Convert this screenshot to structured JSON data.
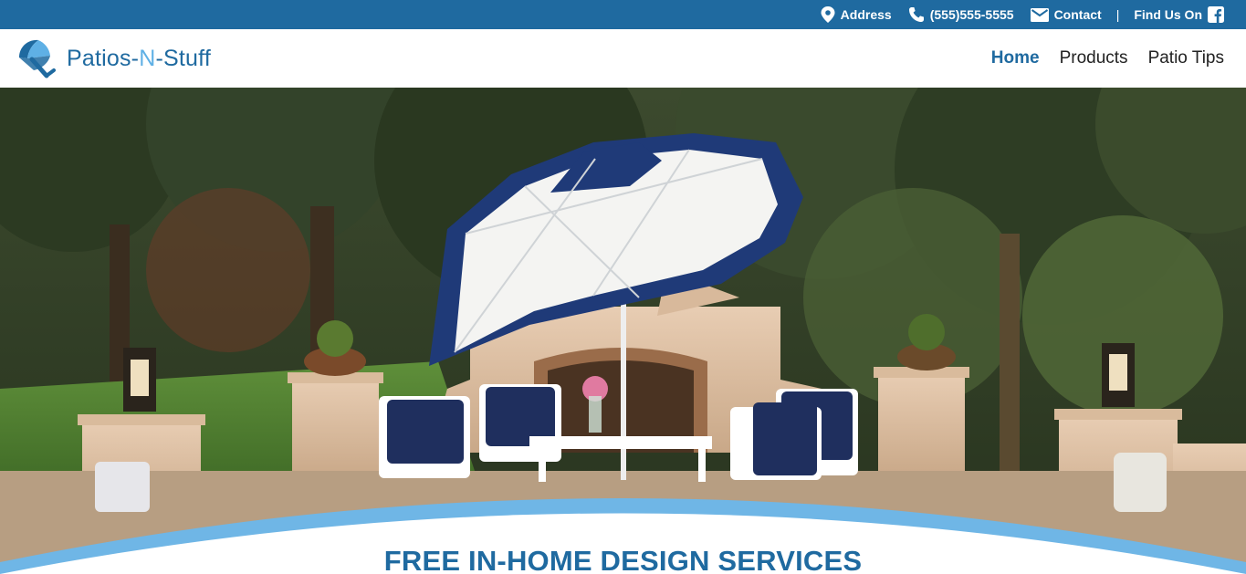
{
  "topbar": {
    "address_label": "Address",
    "phone_label": "(555)555-5555",
    "contact_label": "Contact",
    "separator": "|",
    "find_us_label": "Find Us On"
  },
  "brand": {
    "name_part1": "Patios-",
    "name_part2": "N",
    "name_part3": "-Stuff"
  },
  "nav": {
    "items": [
      {
        "label": "Home",
        "active": true
      },
      {
        "label": "Products",
        "active": false
      },
      {
        "label": "Patio Tips",
        "active": false
      }
    ]
  },
  "hero": {
    "heading": "FREE IN-HOME DESIGN SERVICES"
  },
  "icons": {
    "address": "map-pin-icon",
    "phone": "phone-icon",
    "contact": "envelope-icon",
    "social": "facebook-icon",
    "logo": "umbrella-logo-icon"
  },
  "colors": {
    "primary": "#1f6aa0",
    "accent": "#5fb0e5",
    "nav_text": "#222222",
    "hero_curve": "#6fb6e6"
  }
}
